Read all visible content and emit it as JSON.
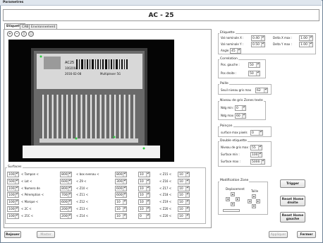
{
  "window": {
    "title": "Parametres"
  },
  "header": {
    "title": "AC - 25"
  },
  "tabs": [
    {
      "label": "Etiquette"
    },
    {
      "label": "CAB"
    },
    {
      "label": "Environnement"
    }
  ],
  "zoom_icons": [
    "zoom-in-icon",
    "zoom-out-icon",
    "zoom-fit-icon",
    "zoom-reset-icon"
  ],
  "etiquette": {
    "title": "Etiquette",
    "val_x_label": "Val nominale X :",
    "val_x": "0.40",
    "val_y_label": "Val nominale Y :",
    "val_y": "0.50",
    "angle_label": "Angle",
    "angle": "45",
    "delta_x_label": "Delta X max :",
    "delta_x": "1.00",
    "delta_y_label": "Delta Y max :",
    "delta_y": "1.00"
  },
  "correlation": {
    "title": "Correlation",
    "pos_gauche_label": "Pos. gauche :",
    "pos_gauche": "50",
    "pos_droite_label": "Pos droite :",
    "pos_droite": "50"
  },
  "paille": {
    "title": "Paille",
    "seuil_label": "Seuil niveau gris max",
    "seuil": "62"
  },
  "niveau_gris": {
    "title": "Niveau de gris Zones texte",
    "min_label": "Ndg min :",
    "min": "0",
    "max_label": "Ndg max :",
    "max": "60"
  },
  "poinçon": {
    "title": "Poinçon",
    "surface_label": "surface max pixels",
    "surface": "0"
  },
  "double": {
    "title": "Double etiquette",
    "niveau_label": "Niveau de gris max :",
    "niveau": "55",
    "surf_min_label": "Surface min :",
    "surf_min": "100",
    "surf_max_label": "Surface max :",
    "surf_max": "5000"
  },
  "modif_zone": {
    "title": "Modification Zone",
    "deplacement": "Deplacement",
    "taille": "Taille"
  },
  "surfaces": {
    "title": "Surfaces",
    "col1": [
      {
        "value": "1000",
        "label": "< Tampon <"
      },
      {
        "value": "500",
        "label": "< Lot <"
      },
      {
        "value": "1000",
        "label": "< Numero de"
      },
      {
        "value": "1000",
        "label": "< Péremption <"
      },
      {
        "value": "1000",
        "label": "< Marque <"
      },
      {
        "value": "1000",
        "label": "< 2C <"
      },
      {
        "value": "1000",
        "label": "< 25C <"
      }
    ],
    "col2": [
      {
        "value": "8000",
        "label": "< box evenau <"
      },
      {
        "value": "6000",
        "label": "< Z9 <"
      },
      {
        "value": "8000",
        "label": "< Z10 <"
      },
      {
        "value": "7000",
        "label": "< Z11 <"
      },
      {
        "value": "6000",
        "label": "< Z12 <"
      },
      {
        "value": "2000",
        "label": "< Z13 <"
      },
      {
        "value": "2000",
        "label": "< Z14 <"
      }
    ],
    "col3": [
      {
        "value": "8000"
      },
      {
        "value": "3000"
      },
      {
        "value": "6000"
      },
      {
        "value": "6000"
      },
      {
        "value": "10"
      },
      {
        "value": "10"
      },
      {
        "value": "10"
      }
    ],
    "col4": [
      {
        "value": "10",
        "label": "< Z15 <"
      },
      {
        "value": "10",
        "label": "< Z16 <"
      },
      {
        "value": "10",
        "label": "< Z17 <"
      },
      {
        "value": "10",
        "label": "< Z18 <"
      },
      {
        "value": "10",
        "label": "< Z19 <"
      },
      {
        "value": "10",
        "label": "< Z20 <"
      },
      {
        "value": "0",
        "label": "< Z20 <"
      }
    ],
    "col5": [
      {
        "value": "10"
      },
      {
        "value": "10"
      },
      {
        "value": "10"
      },
      {
        "value": "10"
      },
      {
        "value": "10"
      },
      {
        "value": "10"
      },
      {
        "value": "10"
      }
    ]
  },
  "buttons": {
    "trigger": "Trigger",
    "reset_home_droite": "Reset Home droite",
    "reset_home_gauche": "Reset Home gauche",
    "rejouer": "Rejouer",
    "master": "Master",
    "appliquer": "Appliquer",
    "fermer": "Fermer"
  },
  "label_image": {
    "line1": "AC25",
    "line2": "1002004",
    "line3": "2016-02-08",
    "line4": "Multiplexer 5G"
  }
}
